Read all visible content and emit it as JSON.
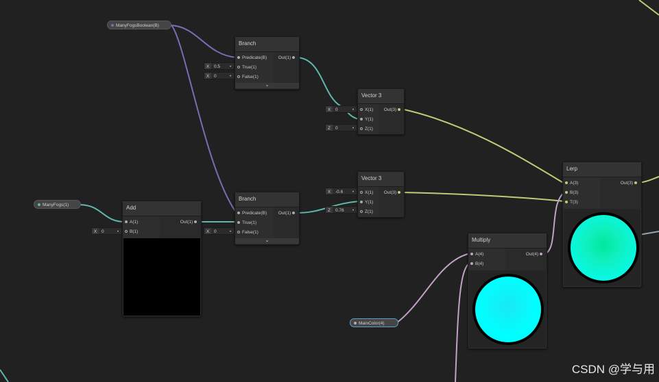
{
  "properties": {
    "many_fogs_boolean": "ManyFogsBoolean(B)",
    "many_fogs": "ManyFogs(1)",
    "main_color": "MainColor(4)"
  },
  "nodes": {
    "branch_top": {
      "title": "Branch",
      "inputs": [
        "Predicate(B)",
        "True(1)",
        "False(1)"
      ],
      "output": "Out(1)",
      "true_field": {
        "axis": "X",
        "value": "0.5"
      },
      "false_field": {
        "axis": "X",
        "value": "0"
      }
    },
    "branch_bottom": {
      "title": "Branch",
      "inputs": [
        "Predicate(B)",
        "True(1)",
        "False(1)"
      ],
      "output": "Out(1)",
      "false_field": {
        "axis": "X",
        "value": "0"
      }
    },
    "vector3_top": {
      "title": "Vector 3",
      "inputs": [
        "X(1)",
        "Y(1)",
        "Z(1)"
      ],
      "output": "Out(3)",
      "x_field": {
        "axis": "X",
        "value": "0"
      },
      "z_field": {
        "axis": "Z",
        "value": "0"
      }
    },
    "vector3_bottom": {
      "title": "Vector 3",
      "inputs": [
        "X(1)",
        "Y(1)",
        "Z(1)"
      ],
      "output": "Out(3)",
      "x_field": {
        "axis": "X",
        "value": "-0.6"
      },
      "z_field": {
        "axis": "Z",
        "value": "0.76"
      }
    },
    "add": {
      "title": "Add",
      "inputs": [
        "A(1)",
        "B(1)"
      ],
      "output": "Out(1)",
      "b_field": {
        "axis": "X",
        "value": "0"
      }
    },
    "lerp": {
      "title": "Lerp",
      "inputs": [
        "A(3)",
        "B(3)",
        "T(3)"
      ],
      "output": "Out(3)"
    },
    "multiply": {
      "title": "Multiply",
      "inputs": [
        "A(4)",
        "B(4)"
      ],
      "output": "Out(4)"
    }
  },
  "icons": {
    "collapse": "chevron-down-icon",
    "port": "port-dot-icon"
  },
  "colors": {
    "background": "#212121",
    "wire_boolean": "#7d6bb3",
    "wire_float": "#5fb8ad",
    "wire_vector3": "#c4c97a",
    "wire_vector4": "#c2a1c6",
    "preview_black": "#000000",
    "preview_cyan": "#00ffff"
  },
  "watermark": "CSDN @学与用"
}
